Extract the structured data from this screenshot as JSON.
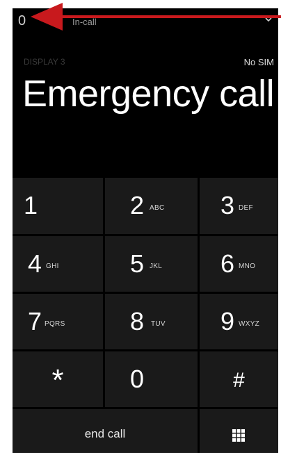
{
  "status": {
    "time": "0",
    "call_state": "In-call"
  },
  "header": {
    "subline": "DISPLAY 3",
    "carrier": "No SIM"
  },
  "title": "Emergency call",
  "keypad": {
    "keys": [
      {
        "digit": "1",
        "letters": ""
      },
      {
        "digit": "2",
        "letters": "ABC"
      },
      {
        "digit": "3",
        "letters": "DEF"
      },
      {
        "digit": "4",
        "letters": "GHI"
      },
      {
        "digit": "5",
        "letters": "JKL"
      },
      {
        "digit": "6",
        "letters": "MNO"
      },
      {
        "digit": "7",
        "letters": "PQRS"
      },
      {
        "digit": "8",
        "letters": "TUV"
      },
      {
        "digit": "9",
        "letters": "WXYZ"
      },
      {
        "digit": "*",
        "letters": ""
      },
      {
        "digit": "0",
        "letters": ""
      },
      {
        "digit": "#",
        "letters": ""
      }
    ],
    "end_call_label": "end call"
  },
  "icons": {
    "chevron": "chevron-down-icon",
    "keypad_toggle": "keypad-grid-icon",
    "annotation": "red-arrow-icon"
  },
  "colors": {
    "background": "#000000",
    "key": "#1a1a1a",
    "arrow": "#c8191d"
  }
}
